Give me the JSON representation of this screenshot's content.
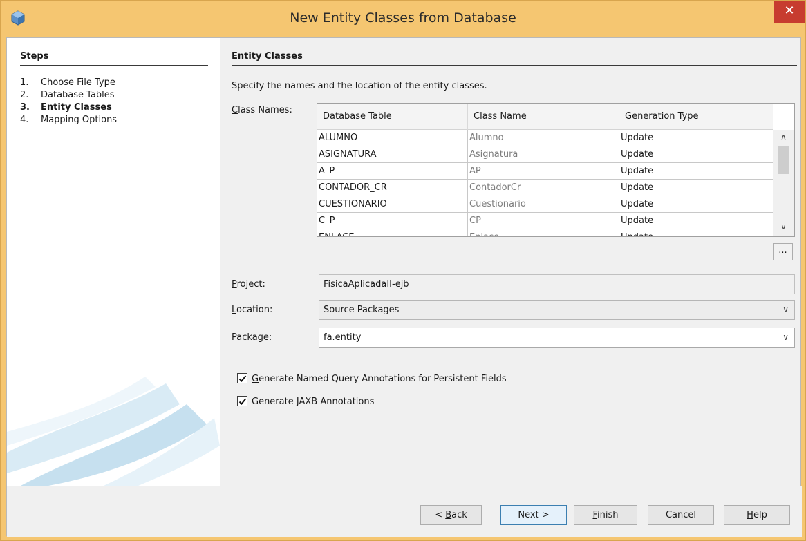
{
  "window": {
    "title": "New Entity Classes from Database",
    "close_glyph": "✕",
    "app_icon": "netbeans-cube-icon"
  },
  "steps": {
    "heading": "Steps",
    "items": [
      {
        "num": "1.",
        "label": "Choose File Type",
        "active": false
      },
      {
        "num": "2.",
        "label": "Database Tables",
        "active": false
      },
      {
        "num": "3.",
        "label": "Entity Classes",
        "active": true
      },
      {
        "num": "4.",
        "label": "Mapping Options",
        "active": false
      }
    ]
  },
  "main": {
    "heading": "Entity Classes",
    "description": "Specify the names and the location of the entity classes.",
    "class_names_label": {
      "underlined": "C",
      "rest": "lass Names:"
    },
    "table": {
      "columns": [
        "Database Table",
        "Class Name",
        "Generation Type"
      ],
      "rows": [
        {
          "table": "ALUMNO",
          "class": "Alumno",
          "gen": "Update"
        },
        {
          "table": "ASIGNATURA",
          "class": "Asignatura",
          "gen": "Update"
        },
        {
          "table": "A_P",
          "class": "AP",
          "gen": "Update"
        },
        {
          "table": "CONTADOR_CR",
          "class": "ContadorCr",
          "gen": "Update"
        },
        {
          "table": "CUESTIONARIO",
          "class": "Cuestionario",
          "gen": "Update"
        },
        {
          "table": "C_P",
          "class": "CP",
          "gen": "Update"
        },
        {
          "table": "ENLACE",
          "class": "Enlace",
          "gen": "Update"
        }
      ]
    },
    "ellipsis_label": "...",
    "project": {
      "label_u": "P",
      "label_rest": "roject:",
      "value": "FisicaAplicadaII-ejb"
    },
    "location": {
      "label_u": "L",
      "label_rest": "ocation:",
      "value": "Source Packages"
    },
    "package": {
      "label_pre": "Pac",
      "label_u": "k",
      "label_rest": "age:",
      "value": "fa.entity"
    },
    "checks": [
      {
        "pre": "",
        "u": "G",
        "rest": "enerate Named Query Annotations for Persistent Fields",
        "checked": true
      },
      {
        "pre": "Generate ",
        "u": "J",
        "rest": "AXB Annotations",
        "checked": true
      }
    ],
    "caret_glyph": "∨",
    "scroll_up": "∧",
    "scroll_down": "∨"
  },
  "footer": {
    "back": {
      "pre": "< ",
      "u": "B",
      "rest": "ack"
    },
    "next": "Next >",
    "finish": {
      "u": "F",
      "rest": "inish"
    },
    "cancel": "Cancel",
    "help": {
      "u": "H",
      "rest": "elp"
    }
  },
  "colors": {
    "title_bar": "#f5c671",
    "close_button": "#c73c2f",
    "default_button_border": "#3c7fb1"
  }
}
